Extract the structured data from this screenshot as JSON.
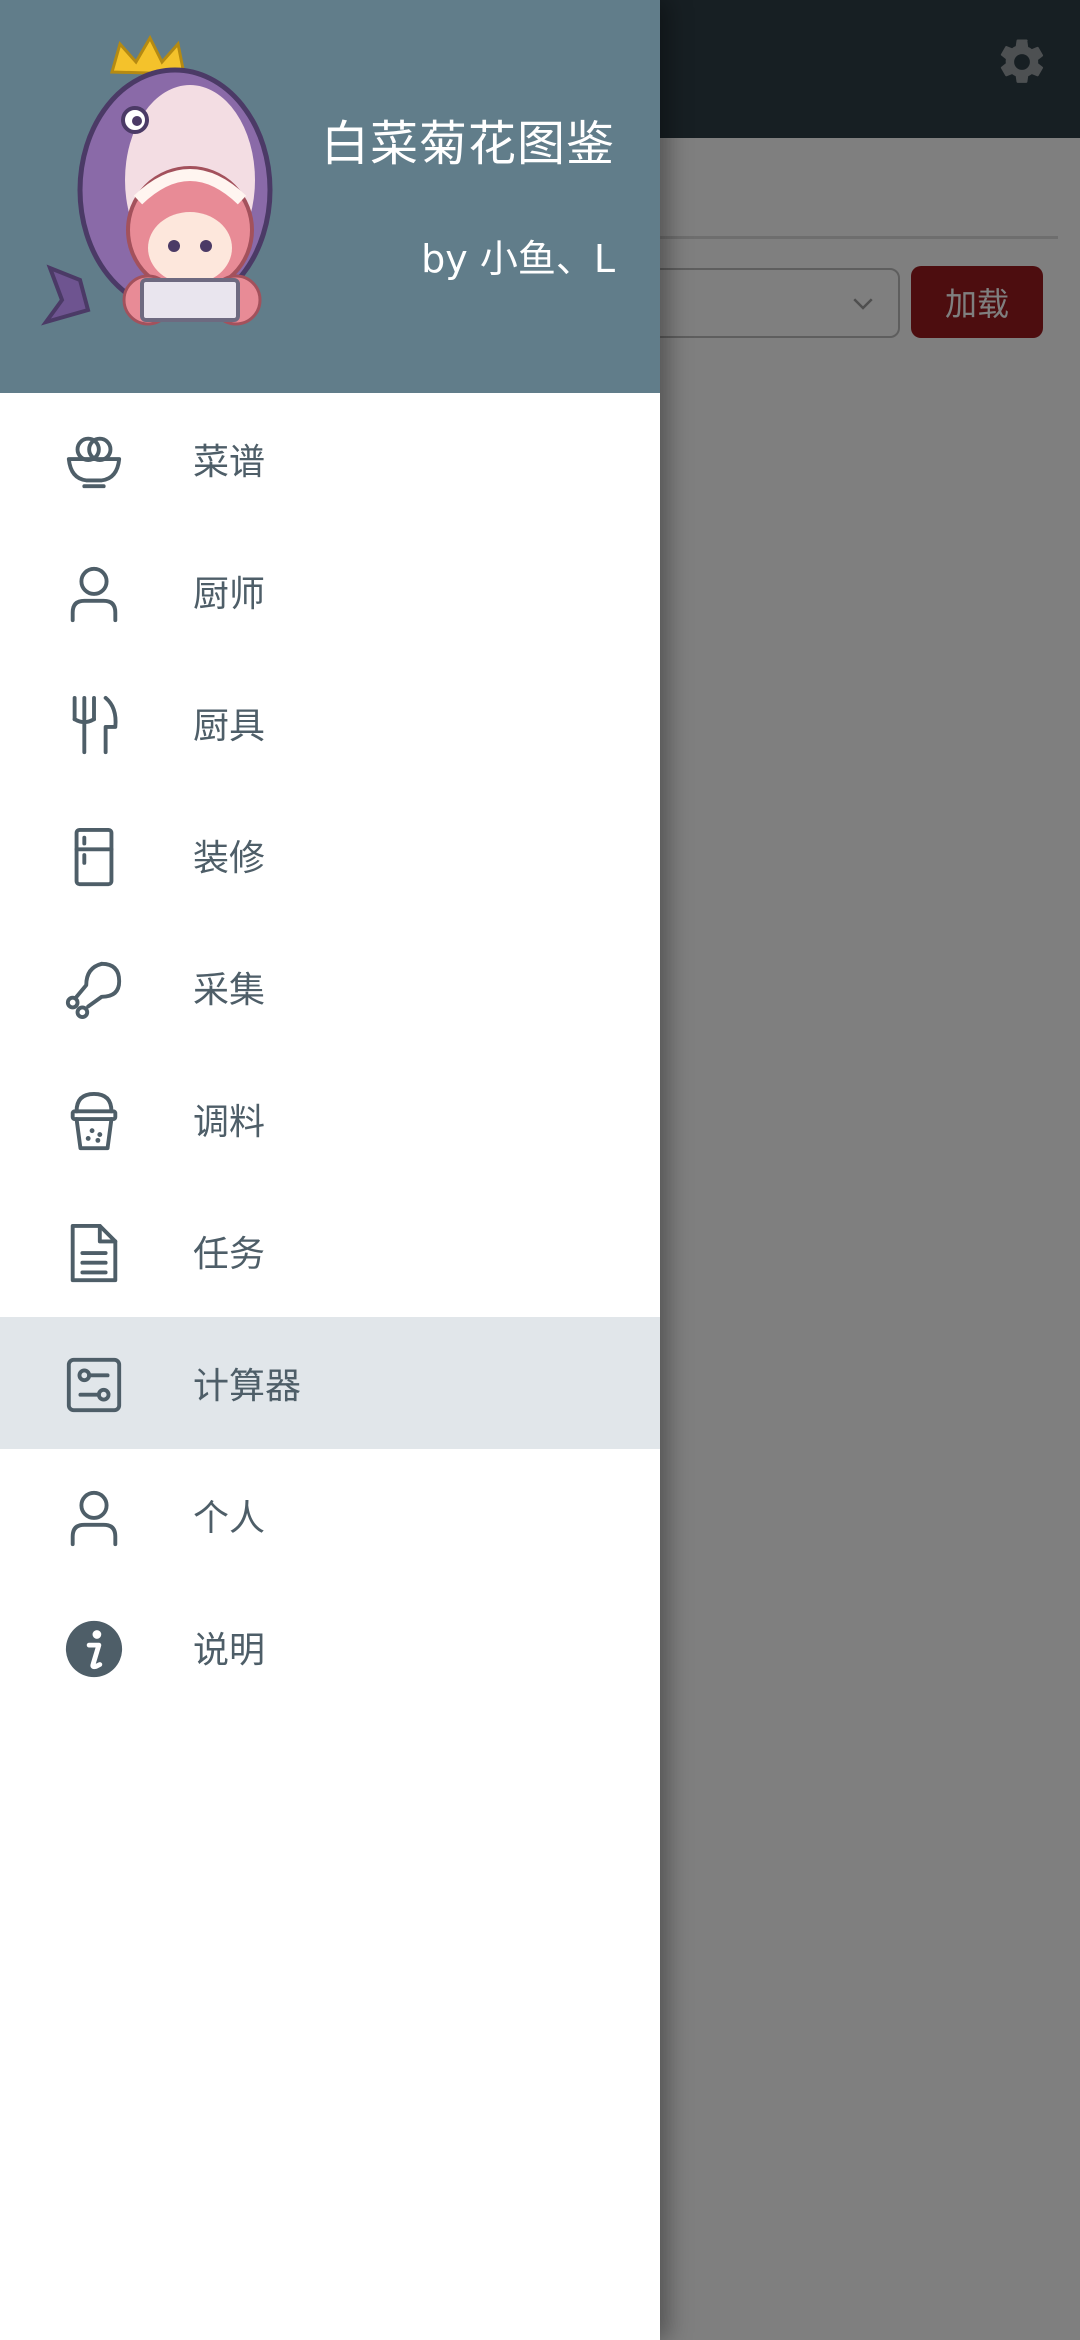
{
  "header": {
    "title": "白菜菊花图鉴",
    "author": "by 小鱼、L"
  },
  "background": {
    "load_button": "加载"
  },
  "menu": {
    "items": [
      {
        "label": "菜谱",
        "icon": "bowl-icon"
      },
      {
        "label": "厨师",
        "icon": "person-icon"
      },
      {
        "label": "厨具",
        "icon": "fork-knife-icon"
      },
      {
        "label": "装修",
        "icon": "fridge-icon"
      },
      {
        "label": "采集",
        "icon": "drumstick-icon"
      },
      {
        "label": "调料",
        "icon": "seasoning-cup-icon"
      },
      {
        "label": "任务",
        "icon": "document-icon"
      },
      {
        "label": "计算器",
        "icon": "calculator-icon",
        "selected": true
      },
      {
        "label": "个人",
        "icon": "person-icon"
      },
      {
        "label": "说明",
        "icon": "info-icon"
      }
    ]
  },
  "colors": {
    "header_bg": "#617d8a",
    "app_bar_bg": "#2f3e47",
    "icon_color": "#4e5e68",
    "selected_bg": "#e1e6ea",
    "load_button_bg": "#9a1a1e"
  }
}
